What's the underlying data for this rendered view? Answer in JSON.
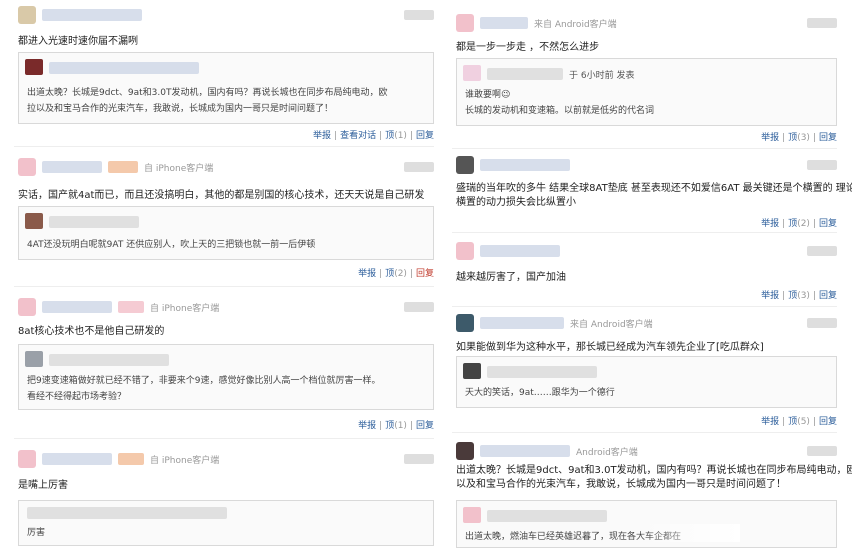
{
  "left": {
    "c1": {
      "content": "都进入光速时速你届不漏咧",
      "quote_text": "出道太晚？长城是9dct、9at和3.0T发动机，国内有吗？再说长城也在同步布局纯电动，欧拉以及和宝马合作的光束汽车，我敢说，长城成为国内一哥只是时间问题了！",
      "quote_line1": "出道太晚？长城是9dct、9at和3.0T发动机，国内有吗？再说长城也在同步布局纯电动，欧",
      "quote_line2": "拉以及和宝马合作的光束汽车，我敢说，长城成为国内一哥只是时间问题了！",
      "report": "举报",
      "conversation": "查看对话",
      "top": "顶",
      "top_count": "(1)",
      "reply": "回复"
    },
    "c2": {
      "source": "自 iPhone客户端",
      "content": "实话，国产就4at而已，而且还没搞明白，其他的都是别国的核心技术，还天天说是自己研发",
      "quote_text": "4AT还没玩明白呢就9AT 还供应别人，吹上天的三把锁也就一前一后伊顿",
      "report": "举报",
      "top": "顶",
      "top_count": "(2)",
      "reply": "回复"
    },
    "c3": {
      "source": "自 iPhone客户端",
      "content": "8at核心技术也不是他自己研发的",
      "quote_line1": "把9速变速箱做好就已经不错了，非要来个9速，感觉好像比别人高一个档位就厉害一样。",
      "quote_line2": "看经不经得起市场考验？",
      "report": "举报",
      "top": "顶",
      "top_count": "(1)",
      "reply": "回复"
    },
    "c4": {
      "source": "自 iPhone客户端",
      "content": "是嘴上厉害",
      "quote_text": "厉害"
    }
  },
  "right": {
    "c1": {
      "source": "来自 Android客户端",
      "content": "都是一步一步走      ，不然怎么进步",
      "quote_meta": "于 6小时前 发表",
      "quote_line1": "谁敢要啊😉",
      "quote_line2": "长城的发动机和变速箱。以前就是低劣的代名词",
      "report": "举报",
      "top": "顶",
      "top_count": "(3)",
      "reply": "回复"
    },
    "c2": {
      "content_line1": "盛瑞的当年吹的多牛  结果全球8AT垫底  甚至表现还不如爱信6AT  最关键还是个横置的  理论上",
      "content_line2": "横置的动力损失会比纵置小",
      "report": "举报",
      "top": "顶",
      "top_count": "(2)",
      "reply": "回复"
    },
    "c3": {
      "content": "越来越厉害了，国产加油",
      "report": "举报",
      "top": "顶",
      "top_count": "(3)",
      "reply": "回复"
    },
    "c4": {
      "source": "来自 Android客户端",
      "content": "如果能做到华为这种水平，那长城已经成为汽车领先企业了[吃瓜群众]",
      "quote_text": "天大的笑话，9at……跟华为一个德行",
      "report": "举报",
      "top": "顶",
      "top_count": "(5)",
      "reply": "回复"
    },
    "c5": {
      "source": "Android客户端",
      "content_line1": "出道太晚？长城是9dct、9at和3.0T发动机，国内有吗？再说长城也在同步布局纯电动，欧拉",
      "content_line2": "以及和宝马合作的光束汽车，我敢说，长城成为国内一哥只是时间问题了！",
      "quote_text": "出道太晚，燃油车已经英雄迟暮了，现在各大车企都在"
    }
  },
  "colors": {
    "link": "#2a5c9a",
    "reply_active": "#c0392b"
  }
}
